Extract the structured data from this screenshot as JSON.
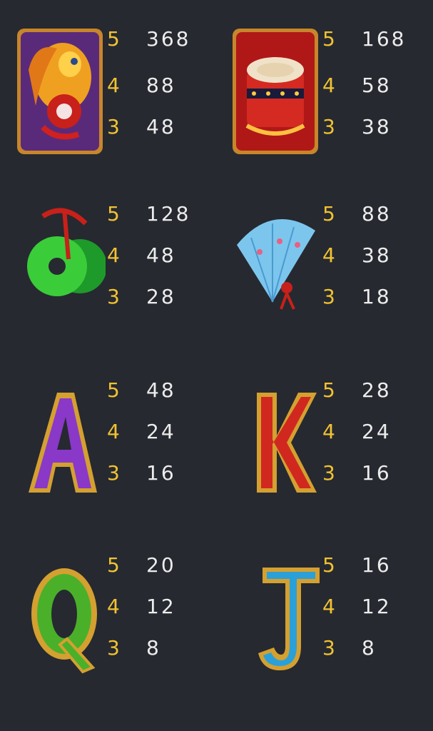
{
  "paytable": [
    {
      "symbol": "koi-fish",
      "pays": [
        {
          "count": "5",
          "value": "368"
        },
        {
          "count": "4",
          "value": "88"
        },
        {
          "count": "3",
          "value": "48"
        }
      ]
    },
    {
      "symbol": "drum",
      "pays": [
        {
          "count": "5",
          "value": "168"
        },
        {
          "count": "4",
          "value": "58"
        },
        {
          "count": "3",
          "value": "38"
        }
      ]
    },
    {
      "symbol": "jade-coins",
      "pays": [
        {
          "count": "5",
          "value": "128"
        },
        {
          "count": "4",
          "value": "48"
        },
        {
          "count": "3",
          "value": "28"
        }
      ]
    },
    {
      "symbol": "fan",
      "pays": [
        {
          "count": "5",
          "value": "88"
        },
        {
          "count": "4",
          "value": "38"
        },
        {
          "count": "3",
          "value": "18"
        }
      ]
    },
    {
      "symbol": "letter-A",
      "pays": [
        {
          "count": "5",
          "value": "48"
        },
        {
          "count": "4",
          "value": "24"
        },
        {
          "count": "3",
          "value": "16"
        }
      ]
    },
    {
      "symbol": "letter-K",
      "pays": [
        {
          "count": "5",
          "value": "28"
        },
        {
          "count": "4",
          "value": "24"
        },
        {
          "count": "3",
          "value": "16"
        }
      ]
    },
    {
      "symbol": "letter-Q",
      "pays": [
        {
          "count": "5",
          "value": "20"
        },
        {
          "count": "4",
          "value": "12"
        },
        {
          "count": "3",
          "value": "8"
        }
      ]
    },
    {
      "symbol": "letter-J",
      "pays": [
        {
          "count": "5",
          "value": "16"
        },
        {
          "count": "4",
          "value": "12"
        },
        {
          "count": "3",
          "value": "8"
        }
      ]
    }
  ],
  "colors": {
    "background": "#262930",
    "count": "#f1c232",
    "value": "#ececec"
  }
}
